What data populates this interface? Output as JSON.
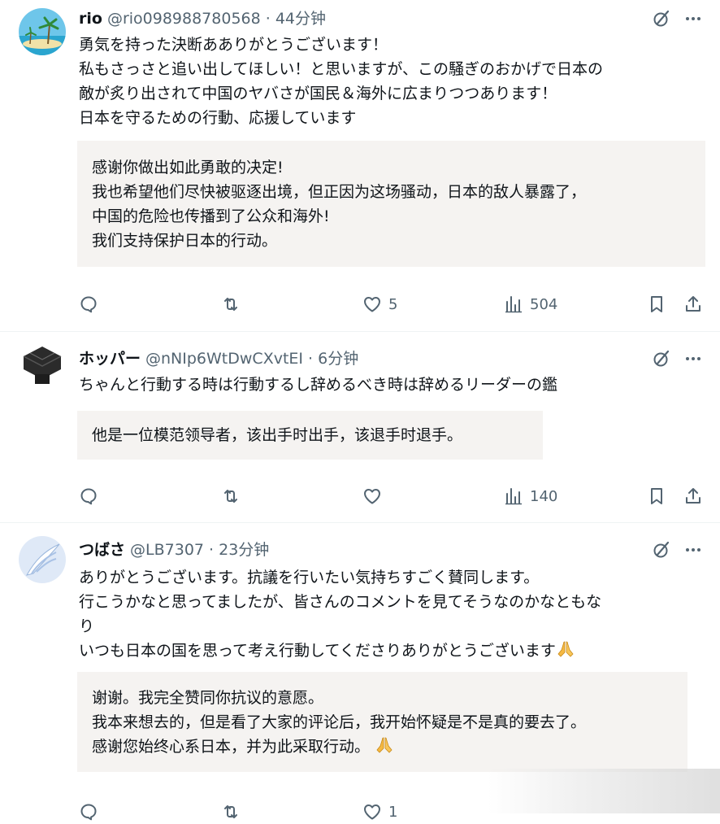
{
  "posts": [
    {
      "name": "rio",
      "handle_time": "@rio098988780568 · 44分钟",
      "text": [
        "勇気を持った決断あありがとうございます！",
        "私もさっさと追い出してほしい！と思いますが、この騒ぎのおかげで日本の",
        "敵が炙り出されて中国のヤバさが国民＆海外に広まりつつあります！",
        "日本を守るための行動、応援しています"
      ],
      "translation": [
        "感谢你做出如此勇敢的决定!",
        "我也希望他们尽快被驱逐出境，但正因为这场骚动，日本的敌人暴露了，",
        "中国的危险也传播到了公众和海外!",
        "我们支持保护日本的行动。"
      ],
      "likes": "5",
      "views": "504"
    },
    {
      "name": "ホッパー",
      "handle_time": "@nNIp6WtDwCXvtEI · 6分钟",
      "text": [
        "ちゃんと行動する時は行動するし辞めるべき時は辞めるリーダーの鑑"
      ],
      "translation": [
        "他是一位模范领导者，该出手时出手，该退手时退手。"
      ],
      "likes": "",
      "views": "140"
    },
    {
      "name": "つばさ",
      "handle_time": "@LB7307 · 23分钟",
      "text": [
        "ありがとうございます。抗議を行いたい気持ちすごく賛同します。",
        "行こうかなと思ってましたが、皆さんのコメントを見てそうなのかなともな",
        "り",
        "いつも日本の国を思って考え行動してくださりありがとうございます"
      ],
      "translation": [
        "谢谢。我完全赞同你抗议的意愿。",
        "我本来想去的，但是看了大家的评论后，我开始怀疑是不是真的要去了。",
        "感谢您始终心系日本，并为此采取行动。"
      ],
      "likes": "1",
      "views": ""
    }
  ],
  "icons": {
    "reply": "reply-icon",
    "repost": "repost-icon",
    "like": "heart-icon",
    "views": "views-icon",
    "bookmark": "bookmark-icon",
    "share": "share-icon",
    "grok": "grok-icon",
    "more": "more-icon",
    "emoji": "folded-hands-emoji"
  },
  "colors": {
    "text": "#0f1419",
    "secondary": "#536471",
    "translation_bg": "#f5f3f1",
    "separator": "#eff3f4"
  }
}
